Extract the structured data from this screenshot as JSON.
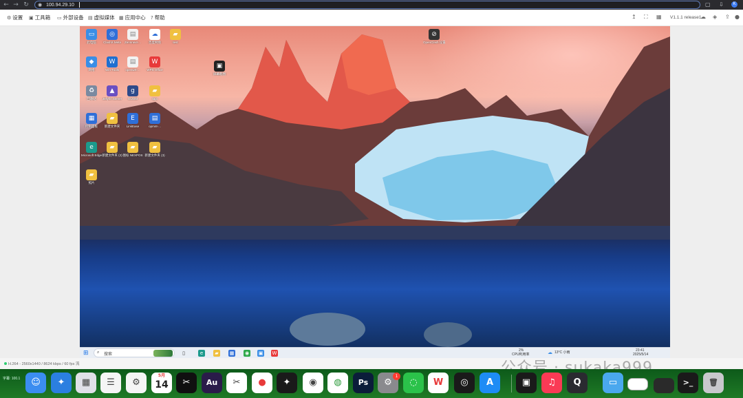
{
  "browser": {
    "url": "100.94.29.10",
    "back_icon": "arrow-left-icon",
    "forward_icon": "arrow-right-icon",
    "reload_icon": "reload-icon",
    "profile_letter": "K"
  },
  "toolbar": {
    "items": [
      {
        "label": "设置",
        "icon": "gear-icon"
      },
      {
        "label": "工具箱",
        "icon": "toolbox-icon"
      },
      {
        "label": "外部设备",
        "icon": "device-icon"
      },
      {
        "label": "虚拟媒体",
        "icon": "media-icon"
      },
      {
        "label": "应用中心",
        "icon": "apps-icon"
      },
      {
        "label": "帮助",
        "icon": "help-icon"
      }
    ],
    "version": "V1.1.1 release1"
  },
  "remote_desktop": {
    "icons": [
      {
        "label": "此电脑",
        "color": "#3a8ee6",
        "glyph": "▭"
      },
      {
        "label": "ClashX.Meta",
        "color": "#2f6fd8",
        "glyph": "◎"
      },
      {
        "label": "Zennnext-...",
        "color": "#f2f2f2",
        "glyph": "▤"
      },
      {
        "label": "百度网盘",
        "color": "#ffffff",
        "glyph": "☁"
      },
      {
        "label": "test",
        "color": "#f0c040",
        "glyph": "▰"
      },
      {
        "label": "网络",
        "color": "#3a8ee6",
        "glyph": "◆"
      },
      {
        "label": "Win-Tools",
        "color": "#1f6fd0",
        "glyph": "W"
      },
      {
        "label": "openwrt-...",
        "color": "#f2f2f2",
        "glyph": "▤"
      },
      {
        "label": "WPS Office",
        "color": "#e83a3a",
        "glyph": "W"
      },
      {
        "label": "回收站",
        "color": "#7b8aa0",
        "glyph": "♻"
      },
      {
        "label": "Jellyfin Server",
        "color": "#6a4fc2",
        "glyph": "▲"
      },
      {
        "label": "GUOM",
        "color": "#2e4a8a",
        "glyph": "g"
      },
      {
        "label": "tapi",
        "color": "#f0c040",
        "glyph": "▰"
      },
      {
        "label": "控制面板",
        "color": "#2f6fd8",
        "glyph": "▦"
      },
      {
        "label": "新建文件夹",
        "color": "#f0c040",
        "glyph": "▰"
      },
      {
        "label": "LinkEase",
        "color": "#2f6fd8",
        "glyph": "E"
      },
      {
        "label": "opmnt-...",
        "color": "#2f6fd8",
        "glyph": "▤"
      },
      {
        "label": "Microsoft Edge",
        "color": "#1c9a8c",
        "glyph": "e"
      },
      {
        "label": "新建文件夹 (2)",
        "color": "#f0c040",
        "glyph": "▰"
      },
      {
        "label": "图标 NEXPOS",
        "color": "#f0c040",
        "glyph": "▰"
      },
      {
        "label": "新建文件夹 (3)",
        "color": "#f0c040",
        "glyph": "▰"
      },
      {
        "label": "照片",
        "color": "#f0c040",
        "glyph": "▰"
      }
    ],
    "extra_icons": [
      {
        "label": "屏幕截图",
        "color": "#222222",
        "glyph": "▣"
      },
      {
        "label": "OpenClash 设置",
        "color": "#333333",
        "glyph": "⊘"
      }
    ]
  },
  "windows_taskbar": {
    "search_placeholder": "搜索",
    "cpu_label": "2%",
    "cpu_sub": "CPU利用率",
    "weather": "13°C 小雨",
    "time": "23:41",
    "date": "2025/5/14"
  },
  "status": {
    "text": "H.264 - 2560x1440 / 8624 kbps / 60 fps 流"
  },
  "watermark": "公众号 · sukaka999",
  "dock": {
    "left_text": "字幕: 100.1",
    "calendar_month": "5月",
    "calendar_day": "14",
    "settings_badge": "1",
    "apps": [
      {
        "name": "Finder",
        "color": "#3b8df0",
        "glyph": "☺"
      },
      {
        "name": "Safari",
        "color": "#2b7fe0",
        "glyph": "✦"
      },
      {
        "name": "Launchpad",
        "color": "#e0e0e8",
        "glyph": "▦"
      },
      {
        "name": "Reminders",
        "color": "#f5f5f5",
        "glyph": "☰"
      },
      {
        "name": "Screen Sharing",
        "color": "#f5f5f5",
        "glyph": "⚙"
      },
      {
        "name": "Calendar",
        "color": "#ffffff",
        "glyph": ""
      },
      {
        "name": "CapCut",
        "color": "#101010",
        "glyph": "✂"
      },
      {
        "name": "Audition",
        "color": "#2a1b4a",
        "glyph": "Au"
      },
      {
        "name": "CapCut Pro",
        "color": "#ffffff",
        "glyph": "✂"
      },
      {
        "name": "Apple Store",
        "color": "#ffffff",
        "glyph": "●"
      },
      {
        "name": "Final Cut",
        "color": "#1a1a1a",
        "glyph": "✦"
      },
      {
        "name": "Signal",
        "color": "#ffffff",
        "glyph": "◉"
      },
      {
        "name": "Chrome",
        "color": "#ffffff",
        "glyph": "◍"
      },
      {
        "name": "Photoshop",
        "color": "#0b1d3a",
        "glyph": "Ps"
      },
      {
        "name": "System Settings",
        "color": "#8a8a8e",
        "glyph": "⚙"
      },
      {
        "name": "WeChat",
        "color": "#2bc24a",
        "glyph": "◌"
      },
      {
        "name": "WPS",
        "color": "#ffffff",
        "glyph": "W"
      },
      {
        "name": "OBS",
        "color": "#1a1a1a",
        "glyph": "◎"
      },
      {
        "name": "App Store",
        "color": "#1e8cf5",
        "glyph": "A"
      },
      {
        "name": "Screen Capture",
        "color": "#1a1a1a",
        "glyph": "▣"
      },
      {
        "name": "Music",
        "color": "#fa3a55",
        "glyph": "♫"
      },
      {
        "name": "QuickTime",
        "color": "#2a2a30",
        "glyph": "Q"
      },
      {
        "name": "Folder",
        "color": "#4aa8ee",
        "glyph": "▭"
      },
      {
        "name": "Window",
        "color": "#ffffff",
        "glyph": ""
      },
      {
        "name": "Window 2",
        "color": "#2a2a2a",
        "glyph": ""
      },
      {
        "name": "Terminal",
        "color": "#1a1a1a",
        "glyph": ">_"
      },
      {
        "name": "Trash",
        "color": "#c8c8cc",
        "glyph": "🗑"
      }
    ]
  }
}
